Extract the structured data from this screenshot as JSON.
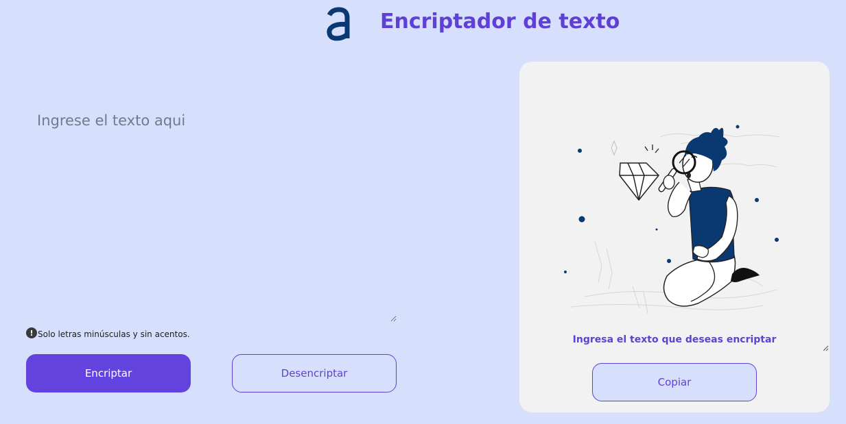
{
  "header": {
    "title": "Encriptador de texto",
    "logo_icon": "alura-logo-icon"
  },
  "input": {
    "placeholder": "Ingrese el texto aqui",
    "value": ""
  },
  "hint": {
    "icon": "exclamation-circle-icon",
    "text": "Solo letras minúsculas y sin acentos."
  },
  "actions": {
    "encrypt_label": "Encriptar",
    "decrypt_label": "Desencriptar"
  },
  "output": {
    "illustration": "person-with-magnifying-glass-and-diamond",
    "message": "Ingresa el texto que deseas encriptar",
    "copy_label": "Copiar"
  },
  "colors": {
    "background": "#d6e0fc",
    "accent": "#5f3fd6",
    "primary_button": "#6243dd",
    "panel": "#f2f2f3",
    "logo": "#0a3871"
  }
}
